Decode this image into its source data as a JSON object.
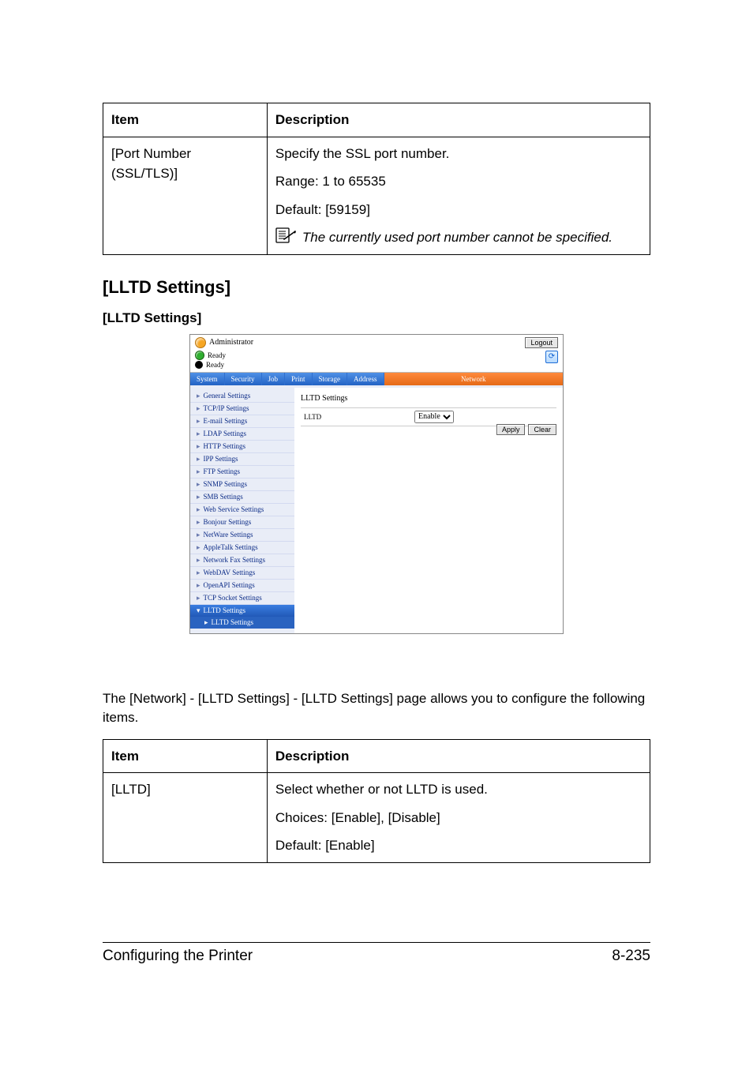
{
  "table1": {
    "head_item": "Item",
    "head_desc": "Description",
    "row_item": "[Port Number (SSL/TLS)]",
    "desc_p1": "Specify the SSL port number.",
    "desc_p2": "Range: 1 to 65535",
    "desc_p3": "Default: [59159]",
    "note": "The currently used port number cannot be specified."
  },
  "section_heading": "[LLTD Settings]",
  "sub_heading": "[LLTD Settings]",
  "screenshot": {
    "admin_label": "Administrator",
    "logout": "Logout",
    "ready1": "Ready",
    "ready2": "Ready",
    "tabs": [
      "System",
      "Security",
      "Job",
      "Print",
      "Storage",
      "Address",
      "Network"
    ],
    "sidebar": [
      "General Settings",
      "TCP/IP Settings",
      "E-mail Settings",
      "LDAP Settings",
      "HTTP Settings",
      "IPP Settings",
      "FTP Settings",
      "SNMP Settings",
      "SMB Settings",
      "Web Service Settings",
      "Bonjour Settings",
      "NetWare Settings",
      "AppleTalk Settings",
      "Network Fax Settings",
      "WebDAV Settings",
      "OpenAPI Settings",
      "TCP Socket Settings"
    ],
    "sidebar_selected": "LLTD Settings",
    "sidebar_sub": "LLTD Settings",
    "content_title": "LLTD Settings",
    "content_label": "LLTD",
    "content_value": "Enable",
    "apply": "Apply",
    "clear": "Clear"
  },
  "body_para": "The [Network] - [LLTD Settings] - [LLTD Settings] page allows you to configure the following items.",
  "table2": {
    "head_item": "Item",
    "head_desc": "Description",
    "row_item": "[LLTD]",
    "desc_p1": "Select whether or not LLTD is used.",
    "desc_p2": "Choices: [Enable], [Disable]",
    "desc_p3": "Default: [Enable]"
  },
  "footer_left": "Configuring the Printer",
  "footer_right": "8-235"
}
